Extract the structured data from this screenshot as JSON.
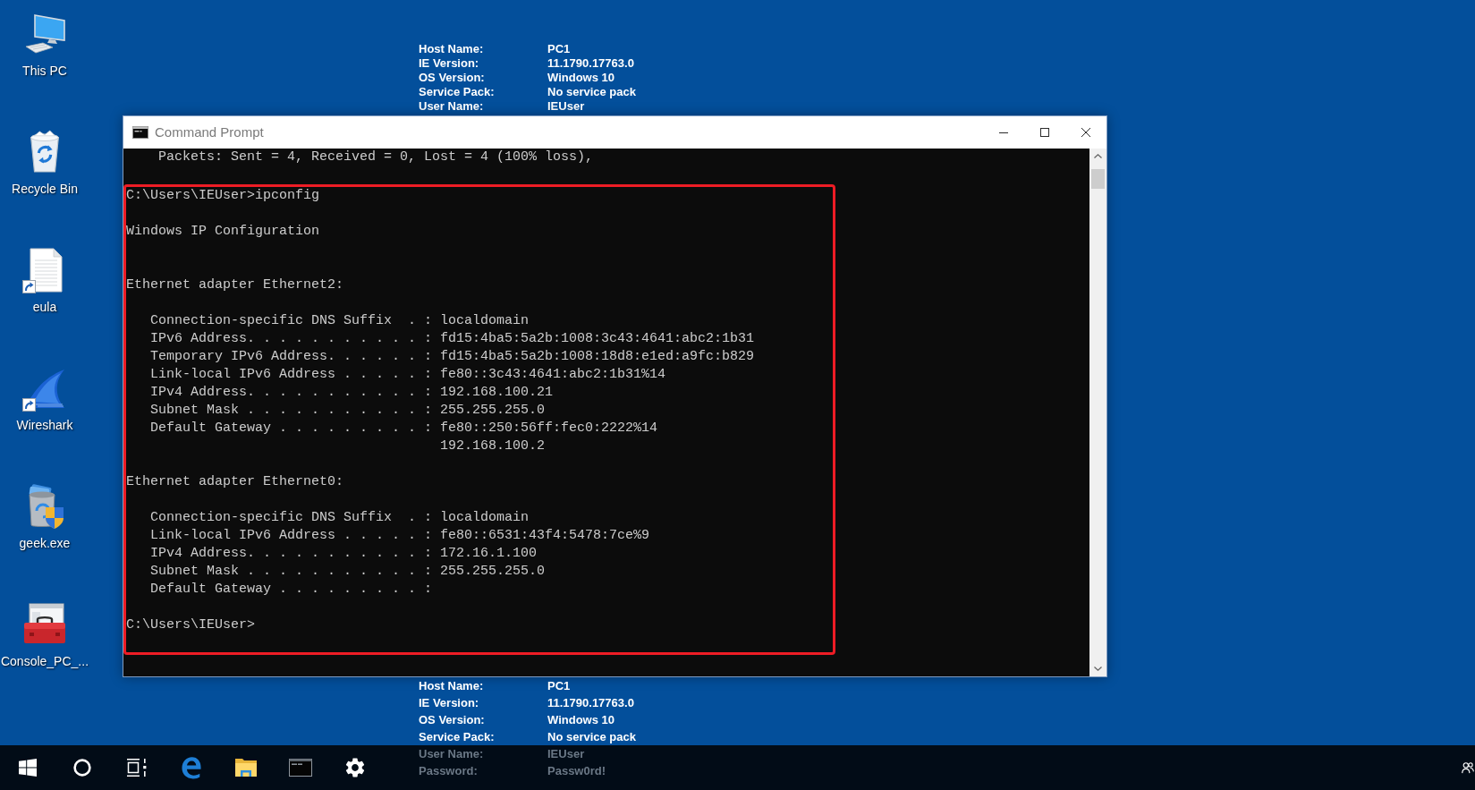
{
  "desktop": {
    "icons": [
      {
        "label": "This PC",
        "kind": "computer",
        "shortcut": false
      },
      {
        "label": "Recycle Bin",
        "kind": "recycle_bin",
        "shortcut": false
      },
      {
        "label": "eula",
        "kind": "document",
        "shortcut": true
      },
      {
        "label": "Wireshark",
        "kind": "shark_fin",
        "shortcut": true
      },
      {
        "label": "geek.exe",
        "kind": "installer",
        "shortcut": false
      },
      {
        "label": "Console_PC_...",
        "kind": "toolbox",
        "shortcut": false
      }
    ],
    "system_info_top": [
      {
        "label": "Host Name:",
        "value": "PC1"
      },
      {
        "label": "IE Version:",
        "value": "11.1790.17763.0"
      },
      {
        "label": "OS Version:",
        "value": "Windows 10"
      },
      {
        "label": "Service Pack:",
        "value": "No service pack"
      },
      {
        "label": "User Name:",
        "value": "IEUser"
      }
    ],
    "system_info_bottom": [
      {
        "label": "Host Name:",
        "value": "PC1",
        "dimmed": false
      },
      {
        "label": "IE Version:",
        "value": "11.1790.17763.0",
        "dimmed": false
      },
      {
        "label": "OS Version:",
        "value": "Windows 10",
        "dimmed": false
      },
      {
        "label": "Service Pack:",
        "value": "No service pack",
        "dimmed": false
      },
      {
        "label": "User Name:",
        "value": "IEUser",
        "dimmed": true
      },
      {
        "label": "Password:",
        "value": "Passw0rd!",
        "dimmed": true
      }
    ]
  },
  "window": {
    "title": "Command Prompt",
    "active": false,
    "console": {
      "sections": [
        {
          "highlighted": false,
          "lines": [
            {
              "kind": "text",
              "text": "    Packets: Sent = 4, Received = 0, Lost = 4 (100% loss),"
            },
            {
              "kind": "blank"
            }
          ]
        },
        {
          "highlighted": true,
          "lines": [
            {
              "kind": "text",
              "text": "C:\\Users\\IEUser>ipconfig"
            },
            {
              "kind": "blank"
            },
            {
              "kind": "text",
              "text": "Windows IP Configuration"
            },
            {
              "kind": "blank"
            },
            {
              "kind": "blank"
            },
            {
              "kind": "text",
              "text": "Ethernet adapter Ethernet2:"
            },
            {
              "kind": "blank"
            },
            {
              "kind": "text",
              "text": "   Connection-specific DNS Suffix  . : localdomain"
            },
            {
              "kind": "text",
              "text": "   IPv6 Address. . . . . . . . . . . : fd15:4ba5:5a2b:1008:3c43:4641:abc2:1b31"
            },
            {
              "kind": "text",
              "text": "   Temporary IPv6 Address. . . . . . : fd15:4ba5:5a2b:1008:18d8:e1ed:a9fc:b829"
            },
            {
              "kind": "text",
              "text": "   Link-local IPv6 Address . . . . . : fe80::3c43:4641:abc2:1b31%14"
            },
            {
              "kind": "text",
              "text": "   IPv4 Address. . . . . . . . . . . : 192.168.100.21"
            },
            {
              "kind": "text",
              "text": "   Subnet Mask . . . . . . . . . . . : 255.255.255.0"
            },
            {
              "kind": "text",
              "text": "   Default Gateway . . . . . . . . . : fe80::250:56ff:fec0:2222%14"
            },
            {
              "kind": "text",
              "text": "                                       192.168.100.2"
            },
            {
              "kind": "blank"
            },
            {
              "kind": "text",
              "text": "Ethernet adapter Ethernet0:"
            },
            {
              "kind": "blank"
            },
            {
              "kind": "text",
              "text": "   Connection-specific DNS Suffix  . : localdomain"
            },
            {
              "kind": "text",
              "text": "   Link-local IPv6 Address . . . . . : fe80::6531:43f4:5478:7ce%9"
            },
            {
              "kind": "text",
              "text": "   IPv4 Address. . . . . . . . . . . : 172.16.1.100"
            },
            {
              "kind": "text",
              "text": "   Subnet Mask . . . . . . . . . . . : 255.255.255.0"
            },
            {
              "kind": "text",
              "text": "   Default Gateway . . . . . . . . . :"
            },
            {
              "kind": "blank"
            },
            {
              "kind": "text",
              "text": "C:\\Users\\IEUser>"
            },
            {
              "kind": "blank"
            }
          ]
        }
      ]
    }
  }
}
